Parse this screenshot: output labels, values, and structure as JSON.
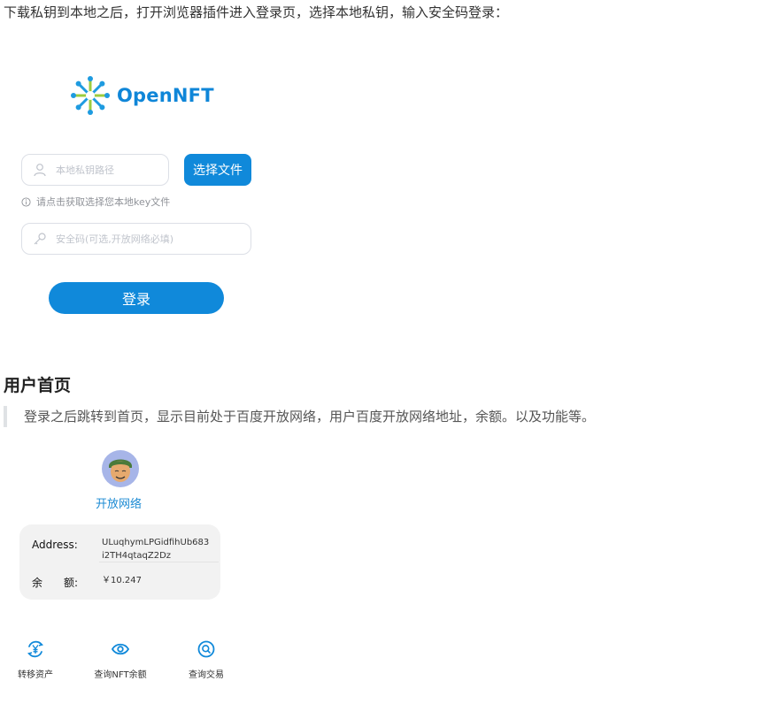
{
  "intro": {
    "text": "下载私钥到本地之后，打开浏览器插件进入登录页，选择本地私钥，输入安全码登录："
  },
  "login": {
    "logo_text": "OpenNFT",
    "key_path_placeholder": "本地私钥路径",
    "choose_file_label": "选择文件",
    "hint_text": "请点击获取选择您本地key文件",
    "security_code_placeholder": "安全码(可选,开放网络必填)",
    "login_label": "登录"
  },
  "section": {
    "title": "用户首页",
    "quote": "登录之后跳转到首页，显示目前处于百度开放网络，用户百度开放网络地址，余额。以及功能等。"
  },
  "home": {
    "network_name": "开放网络",
    "address_label": "Address:",
    "address_value_line1": "ULuqhymLPGidfihUb683",
    "address_value_line2": "i2TH4qtaqZ2Dz",
    "balance_label": "余　　额:",
    "balance_value": "￥10.247",
    "functions": [
      {
        "label": "转移资产",
        "icon": "yen-transfer-icon"
      },
      {
        "label": "查询NFT余额",
        "icon": "eye-icon"
      },
      {
        "label": "查询交易",
        "icon": "search-circle-icon"
      }
    ]
  },
  "colors": {
    "accent": "#1089da",
    "brand_text": "#0f86d8",
    "network_link": "#1b8ad3",
    "card_bg": "#f2f2f2"
  }
}
